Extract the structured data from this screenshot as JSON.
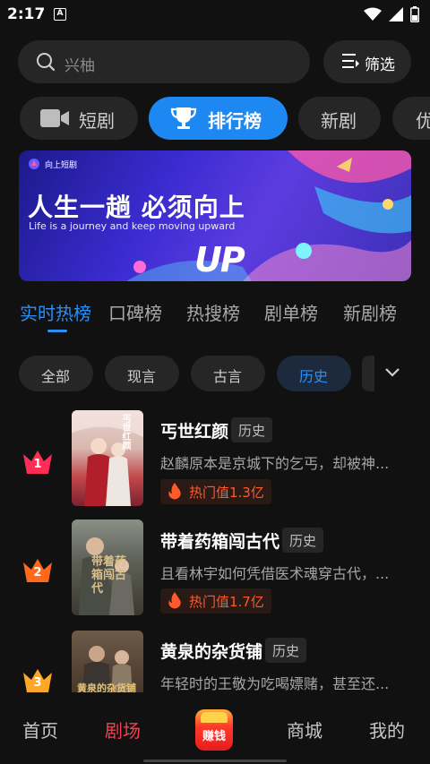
{
  "status": {
    "time": "2:17",
    "a_glyph": "A"
  },
  "search": {
    "placeholder": "兴柚"
  },
  "filter": {
    "label": "筛选"
  },
  "categories": [
    {
      "label": "短剧",
      "active": false
    },
    {
      "label": "排行榜",
      "active": true
    },
    {
      "label": "新剧",
      "active": false
    },
    {
      "label": "优",
      "active": false
    }
  ],
  "banner": {
    "logo_text": "向上短剧",
    "title": "人生一趟  必须向上",
    "subtitle": "Life is a journey and  keep moving upward",
    "art_text": "UP"
  },
  "rank_tabs": [
    {
      "label": "实时热榜",
      "active": true
    },
    {
      "label": "口碑榜",
      "active": false
    },
    {
      "label": "热搜榜",
      "active": false
    },
    {
      "label": "剧单榜",
      "active": false
    },
    {
      "label": "新剧榜",
      "active": false
    }
  ],
  "genres": [
    {
      "label": "全部",
      "active": false
    },
    {
      "label": "现言",
      "active": false
    },
    {
      "label": "古言",
      "active": false
    },
    {
      "label": "历史",
      "active": true
    }
  ],
  "items": [
    {
      "rank": "1",
      "title": "丐世红颜",
      "tag": "历史",
      "desc": "赵麟原本是京城下的乞丐，却被神...",
      "hot": "热门值1.3亿",
      "poster_text": "丐世红颜",
      "crown_color": "#ff2d55"
    },
    {
      "rank": "2",
      "title": "带着药箱闯古代",
      "tag": "历史",
      "desc": "且看林宇如何凭借医术魂穿古代，...",
      "hot": "热门值1.7亿",
      "poster_text": "带着药箱闯古代",
      "crown_color": "#ff6a1a"
    },
    {
      "rank": "3",
      "title": "黄泉的杂货铺",
      "tag": "历史",
      "desc": "年轻时的王敬为吃喝嫖赌，甚至还...",
      "poster_text": "黄泉的杂货铺",
      "crown_color": "#ffa726"
    }
  ],
  "nav": {
    "home": "首页",
    "theater": "剧场",
    "earn": "赚钱",
    "mall": "商城",
    "mine": "我的"
  }
}
